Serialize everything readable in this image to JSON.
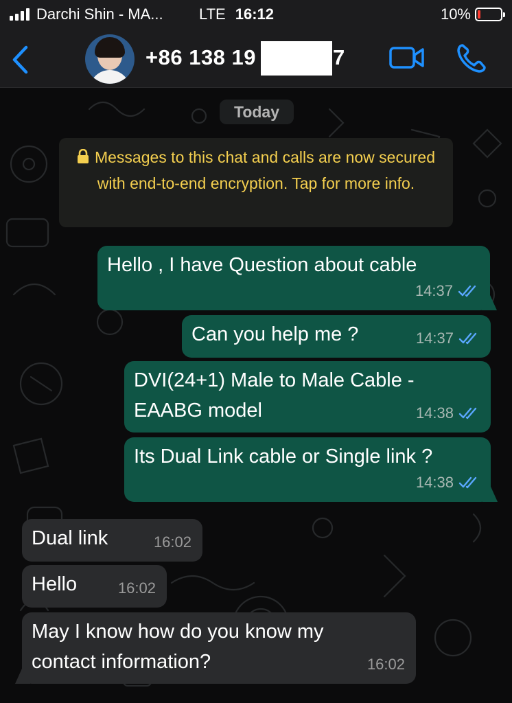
{
  "status_bar": {
    "carrier": "Darchi Shin - MA...",
    "network": "LTE",
    "time": "16:12",
    "battery": "10%"
  },
  "header": {
    "back_icon": "chevron-left-icon",
    "contact_name": "+86 138 19",
    "contact_suffix": "7",
    "video_icon": "video-camera-icon",
    "phone_icon": "phone-icon",
    "accent_color": "#1e90ff"
  },
  "chat": {
    "date_label": "Today",
    "encryption_notice": "Messages to this chat and calls are now secured with end-to-end encryption. Tap for more info.",
    "messages": [
      {
        "direction": "outgoing",
        "lines": [
          "Hello , I have Question about cable"
        ],
        "time": "14:37",
        "status": "read"
      },
      {
        "direction": "outgoing",
        "lines": [
          "Can you help me ?"
        ],
        "time": "14:37",
        "status": "read"
      },
      {
        "direction": "outgoing",
        "lines": [
          "DVI(24+1) Male to Male Cable -",
          "EAABG  model"
        ],
        "time": "14:38",
        "status": "read"
      },
      {
        "direction": "outgoing",
        "lines": [
          "Its Dual Link cable or Single link ?"
        ],
        "time": "14:38",
        "status": "read"
      },
      {
        "direction": "incoming",
        "lines": [
          "Dual link"
        ],
        "time": "16:02"
      },
      {
        "direction": "incoming",
        "lines": [
          "Hello"
        ],
        "time": "16:02"
      },
      {
        "direction": "incoming",
        "lines": [
          "May I know how do you know my",
          "contact information?"
        ],
        "time": "16:02"
      }
    ]
  },
  "colors": {
    "outgoing_bubble": "#0f5545",
    "incoming_bubble": "#2a2b2d",
    "read_ticks": "#5aa7ff",
    "encryption_text": "#f4cf4f"
  }
}
